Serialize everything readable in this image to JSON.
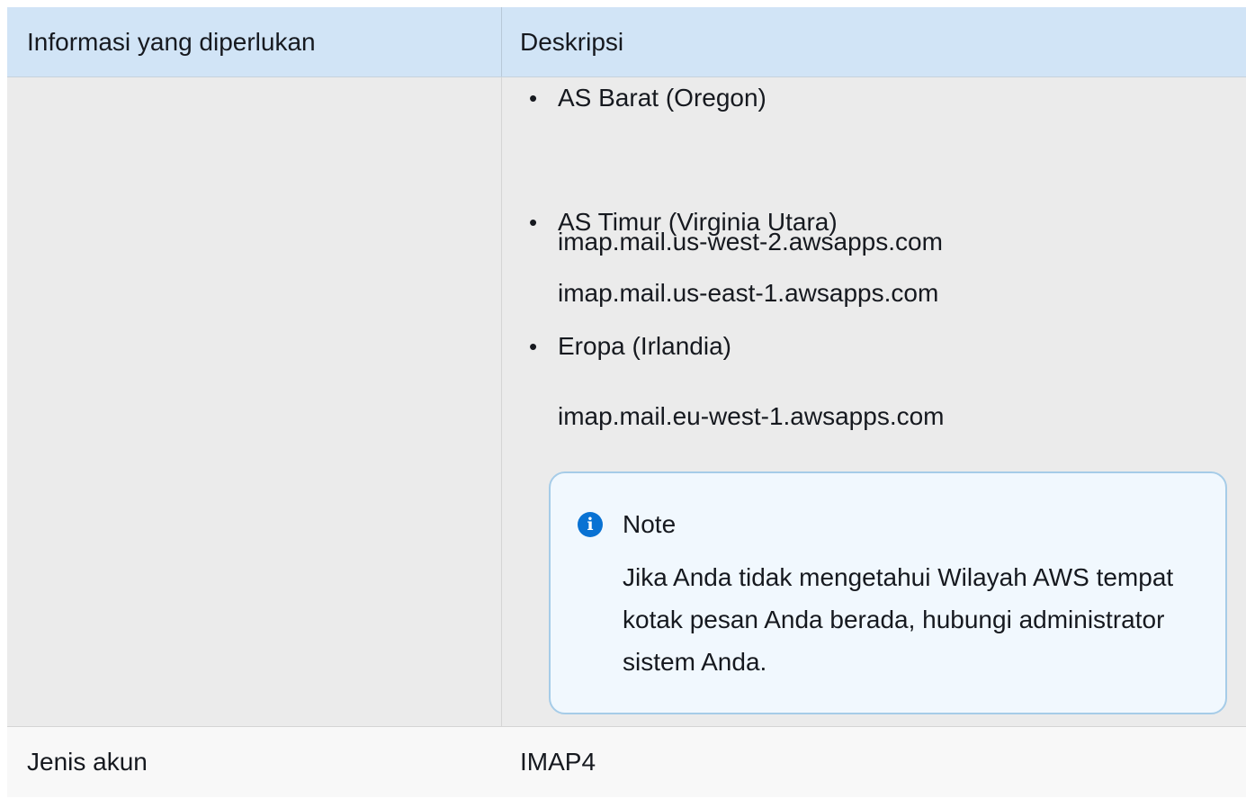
{
  "table": {
    "headers": [
      "Informasi yang diperlukan",
      "Deskripsi"
    ],
    "region_items": [
      {
        "region": "AS Barat (Oregon)",
        "endpoint": "imap.mail.us-west-2.awsapps.com"
      },
      {
        "region": "AS Timur (Virginia Utara)",
        "endpoint": "imap.mail.us-east-1.awsapps.com"
      },
      {
        "region": "Eropa (Irlandia)",
        "endpoint": "imap.mail.eu-west-1.awsapps.com"
      }
    ],
    "note": {
      "title": "Note",
      "text": "Jika Anda tidak mengetahui Wilayah AWS tempat kotak pesan Anda berada, hubungi administrator sistem Anda."
    },
    "rows": [
      {
        "label": "Jenis akun",
        "value": "IMAP4"
      }
    ]
  },
  "colors": {
    "header_bg": "#d1e4f6",
    "row_bg": "#ebebeb",
    "note_bg": "#f1f8fe",
    "note_border": "#a6cce8",
    "info_icon": "#0972d3"
  },
  "icons": {
    "note_icon": "info-circle-icon",
    "bullet": "bullet-dot-icon"
  }
}
